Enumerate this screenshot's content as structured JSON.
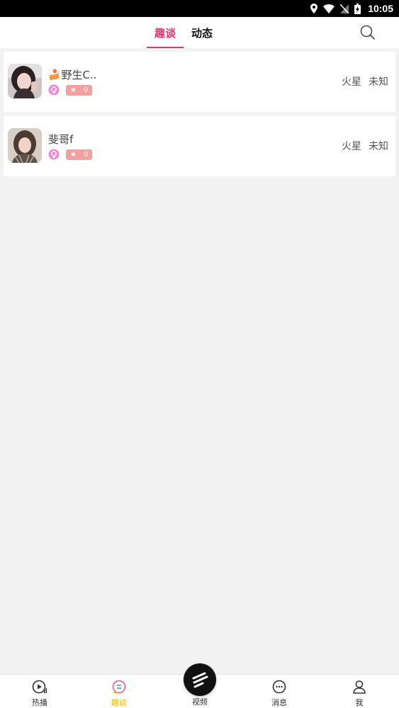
{
  "status_bar": {
    "time": "10:05"
  },
  "header": {
    "tabs": [
      {
        "label": "趣谈",
        "active": true
      },
      {
        "label": "动态",
        "active": false
      }
    ],
    "search_icon": "search-icon"
  },
  "users": [
    {
      "prefix_icon": "🍰",
      "name": "野生C..",
      "level": "0",
      "city": "火星",
      "status": "未知"
    },
    {
      "prefix_icon": "",
      "name": "斐哥f",
      "level": "0",
      "city": "火星",
      "status": "未知"
    }
  ],
  "bottom_nav": {
    "items": [
      {
        "label": "热播",
        "icon": "play-icon"
      },
      {
        "label": "趣谈",
        "icon": "chat-icon",
        "active": true
      },
      {
        "label": "视频",
        "icon": "video-icon"
      },
      {
        "label": "消息",
        "icon": "message-icon"
      },
      {
        "label": "我",
        "icon": "profile-icon"
      }
    ]
  },
  "colors": {
    "accent": "#e8336d",
    "nav_active": "#f5b800",
    "badge": "#f5a0a0"
  }
}
